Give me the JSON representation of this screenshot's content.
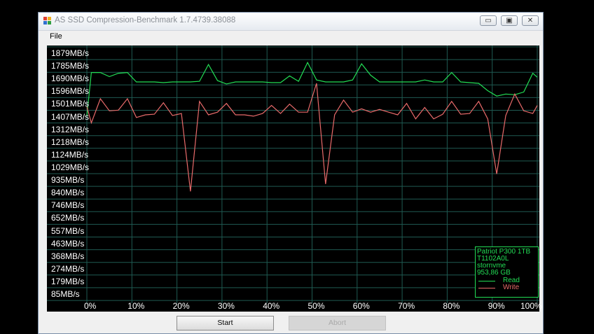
{
  "window": {
    "title": "AS SSD Compression-Benchmark 1.7.4739.38088",
    "controls": {
      "minimize": "▭",
      "maximize": "▣",
      "close": "✕"
    }
  },
  "menu": {
    "file": "File"
  },
  "chart_data": {
    "type": "line",
    "y_ticks": [
      "1879MB/s",
      "1785MB/s",
      "1690MB/s",
      "1596MB/s",
      "1501MB/s",
      "1407MB/s",
      "1312MB/s",
      "1218MB/s",
      "1124MB/s",
      "1029MB/s",
      "935MB/s",
      "840MB/s",
      "746MB/s",
      "652MB/s",
      "557MB/s",
      "463MB/s",
      "368MB/s",
      "274MB/s",
      "179MB/s",
      "85MB/s"
    ],
    "x_ticks": [
      "0%",
      "10%",
      "20%",
      "30%",
      "40%",
      "50%",
      "60%",
      "70%",
      "80%",
      "90%",
      "100%"
    ],
    "ylim": [
      85,
      1879
    ],
    "xlim": [
      0,
      100
    ],
    "grid": true,
    "series": [
      {
        "name": "Read",
        "color": "#22dd55",
        "x": [
          0,
          1,
          3,
          5,
          7,
          9,
          11,
          13,
          15,
          17,
          19,
          21,
          23,
          25,
          27,
          29,
          31,
          33,
          35,
          37,
          39,
          41,
          43,
          45,
          47,
          49,
          51,
          53,
          55,
          57,
          59,
          61,
          63,
          65,
          67,
          69,
          71,
          73,
          75,
          77,
          79,
          81,
          83,
          85,
          87,
          89,
          91,
          93,
          95,
          97,
          99,
          100
        ],
        "y": [
          1410,
          1735,
          1735,
          1705,
          1730,
          1735,
          1665,
          1665,
          1665,
          1660,
          1665,
          1665,
          1665,
          1670,
          1795,
          1675,
          1650,
          1665,
          1665,
          1665,
          1665,
          1660,
          1660,
          1710,
          1670,
          1810,
          1680,
          1665,
          1665,
          1665,
          1680,
          1800,
          1715,
          1665,
          1665,
          1665,
          1665,
          1665,
          1680,
          1665,
          1665,
          1735,
          1665,
          1660,
          1655,
          1600,
          1560,
          1575,
          1570,
          1590,
          1730,
          1700
        ]
      },
      {
        "name": "Write",
        "color": "#e86a6a",
        "x": [
          0,
          1,
          3,
          5,
          7,
          9,
          11,
          13,
          15,
          17,
          19,
          21,
          23,
          25,
          27,
          29,
          31,
          33,
          35,
          37,
          39,
          41,
          43,
          45,
          47,
          49,
          51,
          53,
          55,
          57,
          59,
          61,
          63,
          65,
          67,
          69,
          71,
          73,
          75,
          77,
          79,
          81,
          83,
          85,
          87,
          89,
          91,
          93,
          95,
          97,
          99,
          100
        ],
        "y": [
          1480,
          1360,
          1540,
          1450,
          1455,
          1540,
          1400,
          1420,
          1425,
          1510,
          1415,
          1430,
          850,
          1520,
          1420,
          1440,
          1505,
          1420,
          1420,
          1410,
          1430,
          1490,
          1430,
          1500,
          1440,
          1440,
          1655,
          905,
          1420,
          1530,
          1440,
          1465,
          1440,
          1460,
          1440,
          1420,
          1505,
          1390,
          1475,
          1390,
          1425,
          1520,
          1425,
          1430,
          1520,
          1390,
          980,
          1415,
          1575,
          1450,
          1430,
          1490
        ]
      }
    ]
  },
  "legend": {
    "device": "Patriot P300 1TB",
    "firmware": "T1102A0L",
    "driver": "stornvme",
    "size": "953,86 GB",
    "read_label": "Read",
    "write_label": "Write"
  },
  "buttons": {
    "start": "Start",
    "abort": "Abort"
  }
}
